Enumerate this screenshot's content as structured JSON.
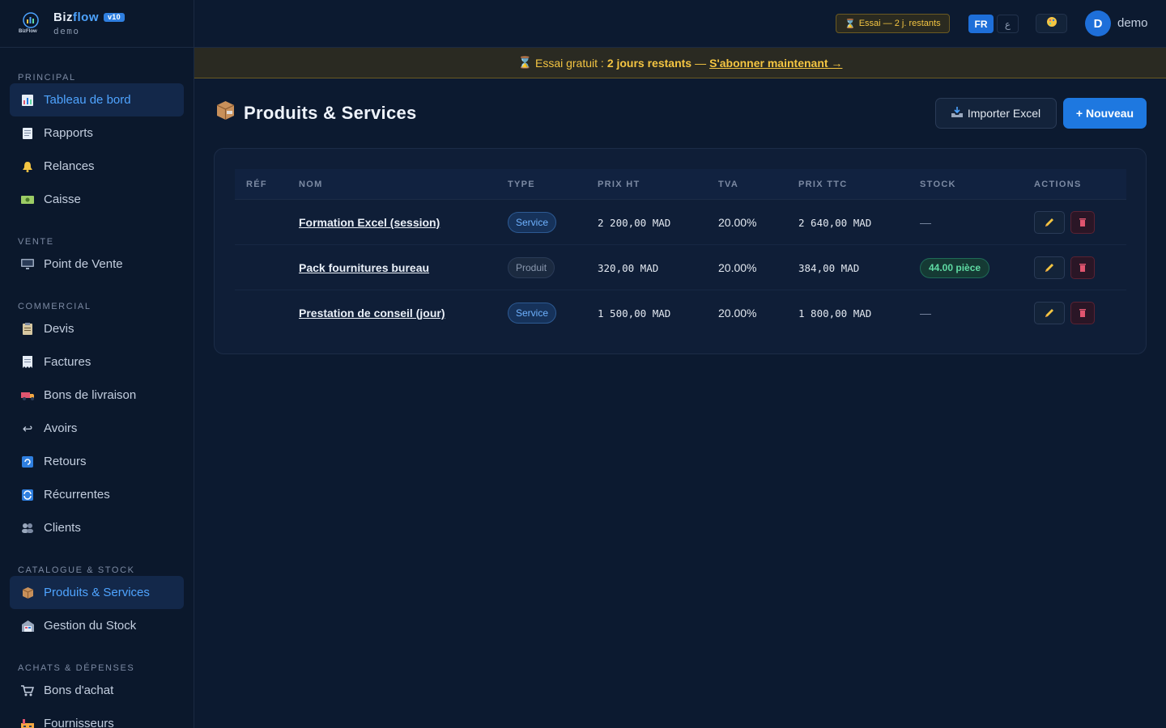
{
  "brand": {
    "name_part1": "Biz",
    "name_part2": "flow",
    "version": "v10",
    "subtitle": "demo",
    "logo_caption": "BizFlow"
  },
  "sidebar": {
    "sections": [
      {
        "title": "PRINCIPAL",
        "items": [
          {
            "label": "Tableau de bord",
            "icon": "bar-chart-icon",
            "active": true
          },
          {
            "label": "Rapports",
            "icon": "document-icon"
          },
          {
            "label": "Relances",
            "icon": "bell-icon"
          },
          {
            "label": "Caisse",
            "icon": "cash-icon"
          }
        ]
      },
      {
        "title": "VENTE",
        "items": [
          {
            "label": "Point de Vente",
            "icon": "monitor-icon"
          }
        ]
      },
      {
        "title": "COMMERCIAL",
        "items": [
          {
            "label": "Devis",
            "icon": "clipboard-icon"
          },
          {
            "label": "Factures",
            "icon": "receipt-icon"
          },
          {
            "label": "Bons de livraison",
            "icon": "truck-icon"
          },
          {
            "label": "Avoirs",
            "icon": "return-arrow-icon"
          },
          {
            "label": "Retours",
            "icon": "refresh-icon"
          },
          {
            "label": "Récurrentes",
            "icon": "repeat-icon"
          },
          {
            "label": "Clients",
            "icon": "users-icon"
          }
        ]
      },
      {
        "title": "CATALOGUE & STOCK",
        "items": [
          {
            "label": "Produits & Services",
            "icon": "package-icon",
            "active": true
          },
          {
            "label": "Gestion du Stock",
            "icon": "warehouse-icon"
          }
        ]
      },
      {
        "title": "ACHATS & DÉPENSES",
        "items": [
          {
            "label": "Bons d'achat",
            "icon": "cart-icon"
          },
          {
            "label": "Fournisseurs",
            "icon": "factory-icon"
          }
        ]
      }
    ]
  },
  "header": {
    "trial_chip": "Essai — 2 j. restants",
    "lang_fr": "FR",
    "lang_ar": "ع",
    "avatar_initial": "D",
    "username": "demo"
  },
  "banner": {
    "prefix": "Essai gratuit :",
    "days": "2 jours restants",
    "separator": "—",
    "cta": "S'abonner maintenant →"
  },
  "page": {
    "title": "Produits & Services",
    "import_button": "Importer Excel",
    "new_button": "+ Nouveau"
  },
  "table": {
    "columns": [
      "RÉF",
      "NOM",
      "TYPE",
      "PRIX HT",
      "TVA",
      "PRIX TTC",
      "STOCK",
      "ACTIONS"
    ],
    "rows": [
      {
        "ref": "",
        "name": "Formation Excel (session)",
        "type": "Service",
        "price_ht": "2 200,00 MAD",
        "tva": "20.00%",
        "price_ttc": "2 640,00 MAD",
        "stock": "—"
      },
      {
        "ref": "",
        "name": "Pack fournitures bureau",
        "type": "Produit",
        "price_ht": "320,00 MAD",
        "tva": "20.00%",
        "price_ttc": "384,00 MAD",
        "stock": "44.00 pièce"
      },
      {
        "ref": "",
        "name": "Prestation de conseil (jour)",
        "type": "Service",
        "price_ht": "1 500,00 MAD",
        "tva": "20.00%",
        "price_ttc": "1 800,00 MAD",
        "stock": "—"
      }
    ]
  },
  "colors": {
    "accent": "#1e78e0",
    "warning": "#f4c542",
    "success": "#5fdba3",
    "danger": "#e0556f"
  }
}
